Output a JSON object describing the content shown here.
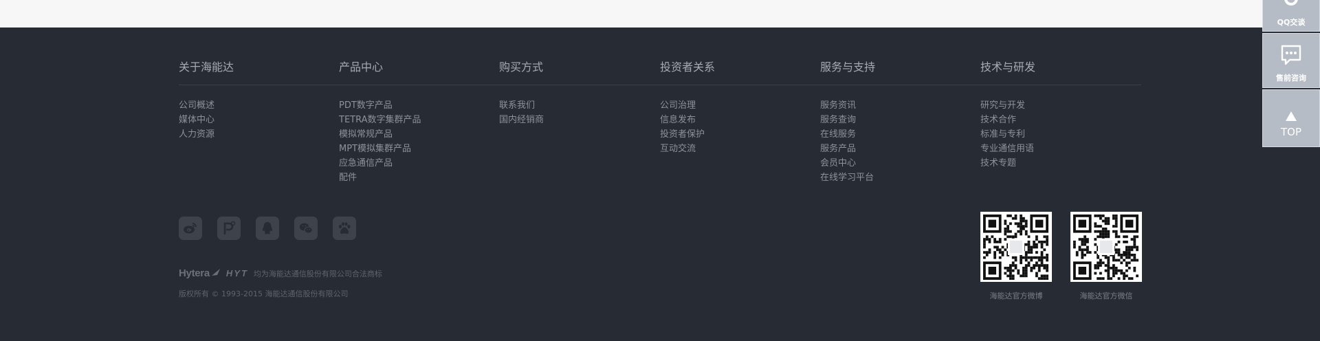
{
  "columns": [
    {
      "title": "关于海能达",
      "items": [
        "公司概述",
        "媒体中心",
        "人力资源"
      ]
    },
    {
      "title": "产品中心",
      "items": [
        "PDT数字产品",
        "TETRA数字集群产品",
        "模拟常规产品",
        "MPT模拟集群产品",
        "应急通信产品",
        "配件"
      ]
    },
    {
      "title": "购买方式",
      "items": [
        "联系我们",
        "国内经销商"
      ]
    },
    {
      "title": "投资者关系",
      "items": [
        "公司治理",
        "信息发布",
        "投资者保护",
        "互动交流"
      ]
    },
    {
      "title": "服务与支持",
      "items": [
        "服务资讯",
        "服务查询",
        "在线服务",
        "服务产品",
        "会员中心",
        "在线学习平台"
      ]
    },
    {
      "title": "技术与研发",
      "items": [
        "研究与开发",
        "技术合作",
        "标准与专利",
        "专业通信用语",
        "技术专题"
      ]
    }
  ],
  "social": [
    {
      "name": "weibo-icon"
    },
    {
      "name": "p-icon"
    },
    {
      "name": "qq-icon"
    },
    {
      "name": "wechat-icon"
    },
    {
      "name": "baidu-icon"
    }
  ],
  "brand": {
    "hytera": "Hytera",
    "hyt": "HYT",
    "trademark": "均为海能达通信股份有限公司合法商标",
    "copyright": "版权所有 © 1993-2015 海能达通信股份有限公司"
  },
  "qr": [
    {
      "caption": "海能达官方微博"
    },
    {
      "caption": "海能达官方微信"
    }
  ],
  "floating": {
    "qq": "QQ交谈",
    "presale": "售前咨询",
    "top": "TOP"
  },
  "colors": {
    "footer_bg": "#272b33",
    "float_bg": "#b6bcc6"
  }
}
